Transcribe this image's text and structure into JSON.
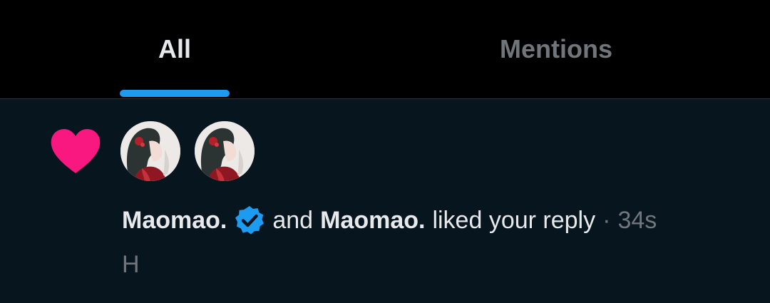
{
  "tabs": {
    "all_label": "All",
    "mentions_label": "Mentions"
  },
  "notification": {
    "icon": "heart-icon",
    "user1": "Maomao.",
    "user1_verified": true,
    "conjunction": "and",
    "user2": "Maomao.",
    "action": "liked your reply",
    "separator": "·",
    "time": "34s",
    "preview": "H"
  },
  "colors": {
    "background_header": "#000000",
    "background_notification": "#07151f",
    "accent": "#1d9bf0",
    "heart": "#f91880",
    "text_primary": "#e7e9ea",
    "text_secondary": "#71767b"
  }
}
